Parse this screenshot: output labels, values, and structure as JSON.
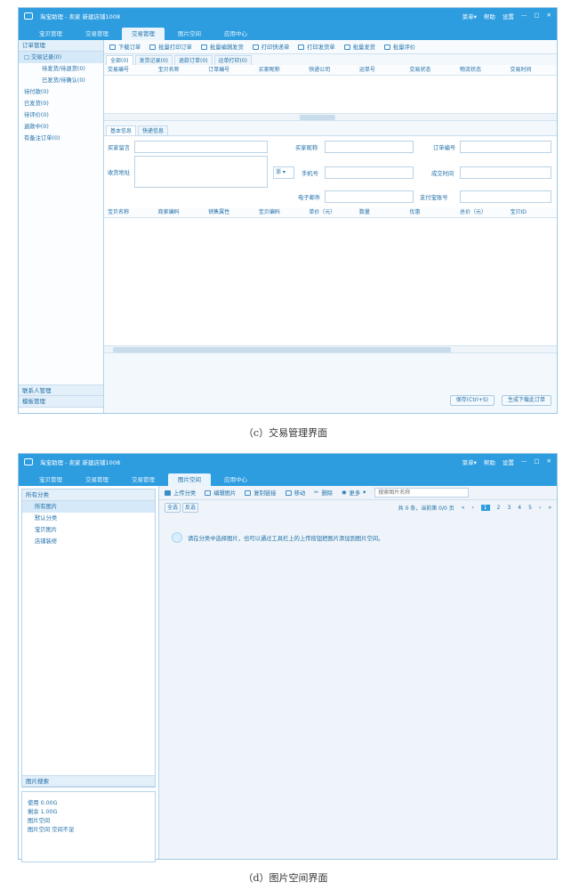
{
  "window_c": {
    "title": "淘宝助理 - 卖家 新建店铺1008",
    "controls": [
      "菜单▾",
      "帮助",
      "设置",
      "—",
      "□",
      "✕"
    ],
    "nav": [
      "宝贝管理",
      "交易管理",
      "交易管理",
      "图片空间",
      "应用中心"
    ],
    "active_nav": 2,
    "sidebar": {
      "header": "订单管理",
      "items": [
        {
          "label": "□ 交易记录(0)",
          "sub": false
        },
        {
          "label": "待发货/待退货(0)",
          "sub": true
        },
        {
          "label": "已发货/待确认(0)",
          "sub": true
        },
        {
          "label": "待付款(0)",
          "sub": false
        },
        {
          "label": "已发货(0)",
          "sub": false
        },
        {
          "label": "待评价(0)",
          "sub": false
        },
        {
          "label": "退款中(0)",
          "sub": false
        },
        {
          "label": "有备注订单(0)",
          "sub": false
        }
      ],
      "bottom_items": [
        "联系人管理",
        "模板管理"
      ]
    },
    "toolbar": [
      "下载订单",
      "批量打印订单",
      "批量编辑发货",
      "打印快递单",
      "打印发货单",
      "批量发货",
      "批量评价"
    ],
    "tabs": [
      "全部(0)",
      "发货记录(0)",
      "退款订单(0)",
      "运单打印(0)"
    ],
    "columns": [
      "交易编号",
      "宝贝名称",
      "订单编号",
      "买家昵称",
      "快递公司",
      "运单号",
      "交易状态",
      "物流状态",
      "交易时间"
    ],
    "detail_tabs": [
      "基本信息",
      "快递信息"
    ],
    "labels": {
      "buyer_note": "买家留言",
      "buyer_address": "收货地址",
      "buyer_nick": "买家昵称",
      "order_no": "订单编号",
      "phone": "手机号",
      "trade_time": "成交时间",
      "email": "电子邮件",
      "alipay": "支付宝账号",
      "region": "浙 ▾"
    },
    "detail_columns": [
      "宝贝名称",
      "商家编码",
      "销售属性",
      "宝贝编码",
      "单价（元）",
      "数量",
      "优惠",
      "总价（元）",
      "宝贝ID"
    ],
    "buttons": [
      "保存(Ctrl+S)",
      "生成下载此订单"
    ]
  },
  "caption_c": "（c）交易管理界面",
  "window_d": {
    "title": "淘宝助理 - 卖家 新建店铺1008",
    "controls": [
      "菜单▾",
      "帮助",
      "设置",
      "—",
      "□",
      "✕"
    ],
    "nav": [
      "宝贝管理",
      "交易管理",
      "交易管理",
      "图片空间",
      "应用中心"
    ],
    "active_nav": 3,
    "sidebar": {
      "header": "所有分类",
      "items": [
        "所有图片",
        "默认分类",
        "宝贝图片",
        "店铺装修"
      ],
      "bottom": "图片搜索",
      "stats": [
        "使用    0.00G",
        "剩余    1.00G",
        "图片空间",
        "图片空间 空间不足"
      ]
    },
    "toolbar": [
      "上传分类",
      "编辑图片",
      "复制链接",
      "移动",
      "删除",
      "更多",
      "搜索图片名称"
    ],
    "select_all": "全选",
    "invert": "反选",
    "pager_info": "共 0 条，当前第 0/0 页",
    "pages": [
      "1",
      "2",
      "3",
      "4",
      "5"
    ],
    "hint": "请在分类中选择图片，也可以通过工具栏上的上传按钮把图片添加到图片空间。"
  },
  "caption_d": "（d）图片空间界面"
}
